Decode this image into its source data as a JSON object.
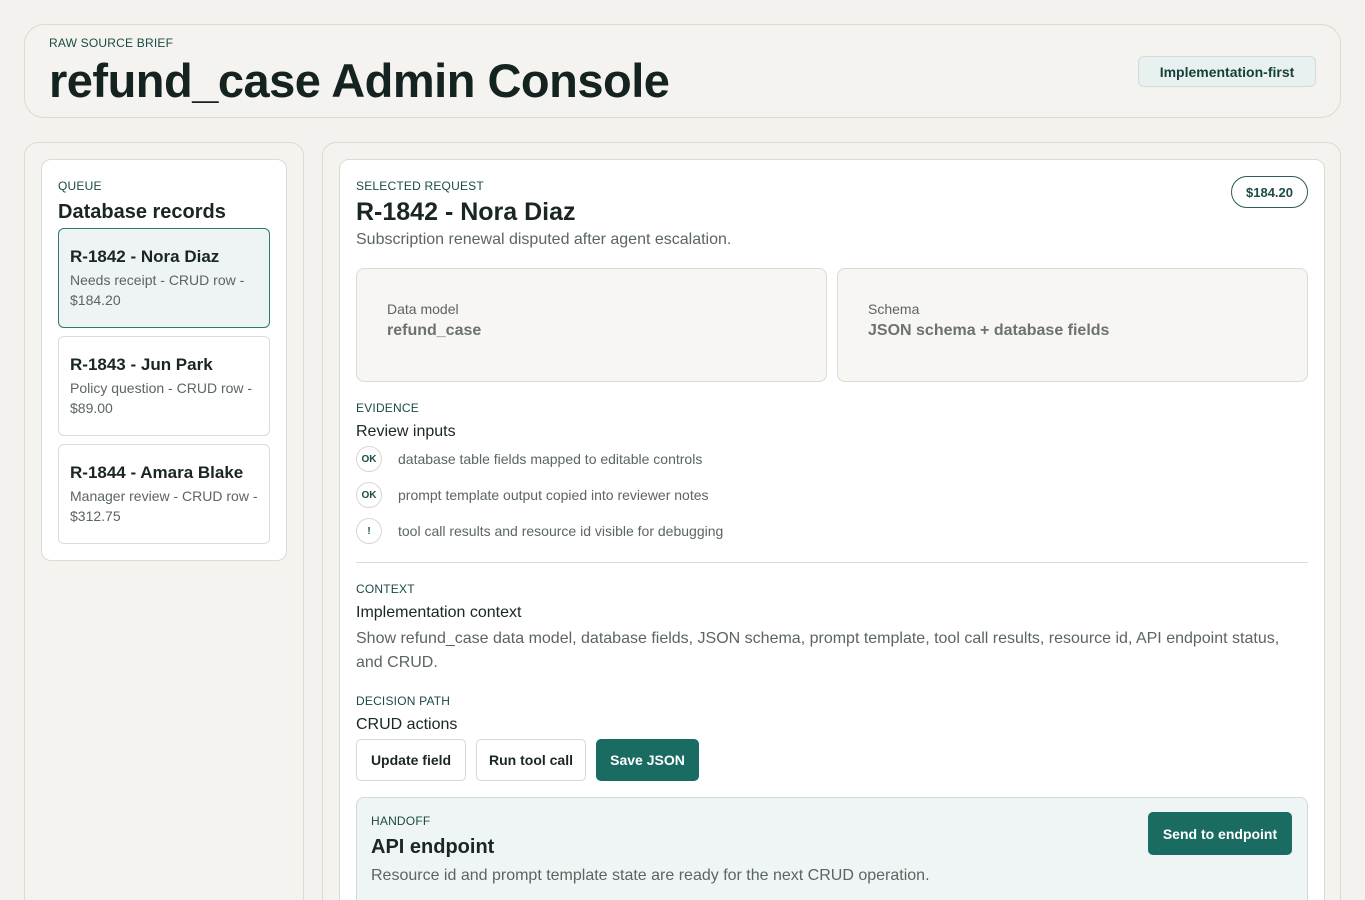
{
  "header": {
    "eyebrow": "RAW SOURCE BRIEF",
    "title": "refund_case Admin Console",
    "mode_badge": "Implementation-first"
  },
  "queue": {
    "eyebrow": "QUEUE",
    "title": "Database records",
    "records": [
      {
        "title": "R-1842 - Nora Diaz",
        "subtitle": "Needs receipt - CRUD row - $184.20",
        "selected": true
      },
      {
        "title": "R-1843 - Jun Park",
        "subtitle": "Policy question - CRUD row - $89.00",
        "selected": false
      },
      {
        "title": "R-1844 - Amara Blake",
        "subtitle": "Manager review - CRUD row - $312.75",
        "selected": false
      }
    ]
  },
  "detail": {
    "eyebrow": "SELECTED REQUEST",
    "title": "R-1842 - Nora Diaz",
    "amount": "$184.20",
    "description": "Subscription renewal disputed after agent escalation.",
    "data_model": {
      "label": "Data model",
      "value": "refund_case"
    },
    "schema": {
      "label": "Schema",
      "value": "JSON schema + database fields"
    },
    "evidence": {
      "eyebrow": "EVIDENCE",
      "title": "Review inputs",
      "items": [
        {
          "badge": "OK",
          "text": "database table fields mapped to editable controls"
        },
        {
          "badge": "OK",
          "text": "prompt template output copied into reviewer notes"
        },
        {
          "badge": "!",
          "text": "tool call results and resource id visible for debugging"
        }
      ]
    },
    "context": {
      "eyebrow": "CONTEXT",
      "title": "Implementation context",
      "text": "Show refund_case data model, database fields, JSON schema, prompt template, tool call results, resource id, API endpoint status, and CRUD."
    },
    "decision": {
      "eyebrow": "DECISION PATH",
      "title": "CRUD actions",
      "update_label": "Update field",
      "tool_call_label": "Run tool call",
      "save_label": "Save JSON"
    },
    "handoff": {
      "eyebrow": "HANDOFF",
      "title": "API endpoint",
      "text": "Resource id and prompt template state are ready for the next CRUD operation.",
      "send_label": "Send to endpoint"
    }
  },
  "colors": {
    "accent": "#1a6b62",
    "background": "#f3f2ee",
    "selected_bg": "#edf4f3"
  }
}
